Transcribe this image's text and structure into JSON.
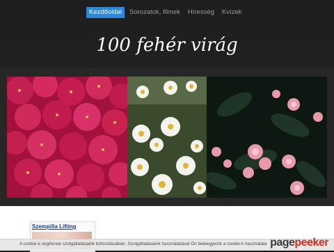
{
  "nav": {
    "items": [
      {
        "label": "Kezdőoldal",
        "active": true
      },
      {
        "label": "Sorozatok, filmek",
        "active": false
      },
      {
        "label": "Híresség",
        "active": false
      },
      {
        "label": "Kvízek",
        "active": false
      }
    ]
  },
  "site": {
    "title": "100 fehér virág"
  },
  "gallery": {
    "photos": [
      "pink-chrysanthemums",
      "white-daisies",
      "pink-flowers-dark-leaves"
    ]
  },
  "sidebar_ad": {
    "title": "Szempilla Lifting"
  },
  "cookie": {
    "text": "A cookie-k segítenek szolgáltatásaink biztosításában. Szolgáltatásaink használatával Ön beleegyezik a cookie-k használata"
  },
  "watermark": {
    "part1": "page",
    "part2": "peeker"
  },
  "colors": {
    "nav_active": "#2f86d6",
    "header_bg": "#1e1e1e",
    "band_bg": "#272727"
  }
}
